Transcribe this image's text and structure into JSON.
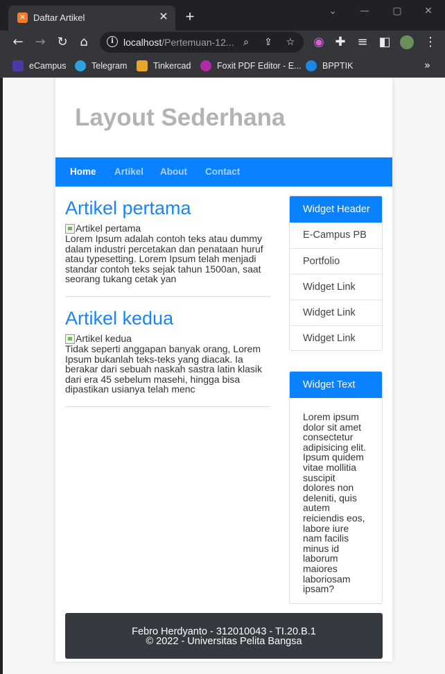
{
  "browser": {
    "tab_title": "Daftar Artikel",
    "tab_favicon_text": "✕",
    "url_host": "localhost",
    "url_path": "/Pertemuan-12...",
    "bookmarks": [
      {
        "label": "eCampus",
        "color": "#4a3aa8"
      },
      {
        "label": "Telegram",
        "color": "#2aa3df"
      },
      {
        "label": "Tinkercad",
        "color": "#e8a52b"
      },
      {
        "label": "Foxit PDF Editor - E...",
        "color": "#b02aa8"
      },
      {
        "label": "BPPTIK",
        "color": "#1e88e5"
      }
    ]
  },
  "site": {
    "title": "Layout Sederhana",
    "nav": [
      {
        "label": "Home",
        "active": true
      },
      {
        "label": "Artikel",
        "active": false
      },
      {
        "label": "About",
        "active": false
      },
      {
        "label": "Contact",
        "active": false
      }
    ],
    "articles": [
      {
        "title": "Artikel pertama",
        "img_alt": "Artikel pertama",
        "body": "Lorem Ipsum adalah contoh teks atau dummy dalam industri percetakan dan penataan huruf atau typesetting. Lorem Ipsum telah menjadi standar contoh teks sejak tahun 1500an, saat seorang tukang cetak yan"
      },
      {
        "title": "Artikel kedua",
        "img_alt": "Artikel kedua",
        "body": "Tidak seperti anggapan banyak orang, Lorem Ipsum bukanlah teks-teks yang diacak. Ia berakar dari sebuah naskah sastra latin klasik dari era 45 sebelum masehi, hingga bisa dipastikan usianya telah menc"
      }
    ],
    "widget_links": {
      "header": "Widget Header",
      "items": [
        "E-Campus PB",
        "Portfolio",
        "Widget Link",
        "Widget Link",
        "Widget Link"
      ]
    },
    "widget_text": {
      "header": "Widget Text",
      "body": "Lorem ipsum dolor sit amet consectetur adipisicing elit. Ipsum quidem vitae mollitia suscipit dolores non deleniti, quis autem reiciendis eos, labore iure nam facilis minus id laborum maiores laboriosam ipsam?"
    },
    "footer": {
      "line1": "Febro Herdyanto - 312010043 - TI.20.B.1",
      "line2": "© 2022 - Universitas Pelita Bangsa"
    }
  },
  "colors": {
    "accent": "#0a82ff",
    "footer_bg": "#343a40",
    "title_gray": "#b3b3b3"
  }
}
